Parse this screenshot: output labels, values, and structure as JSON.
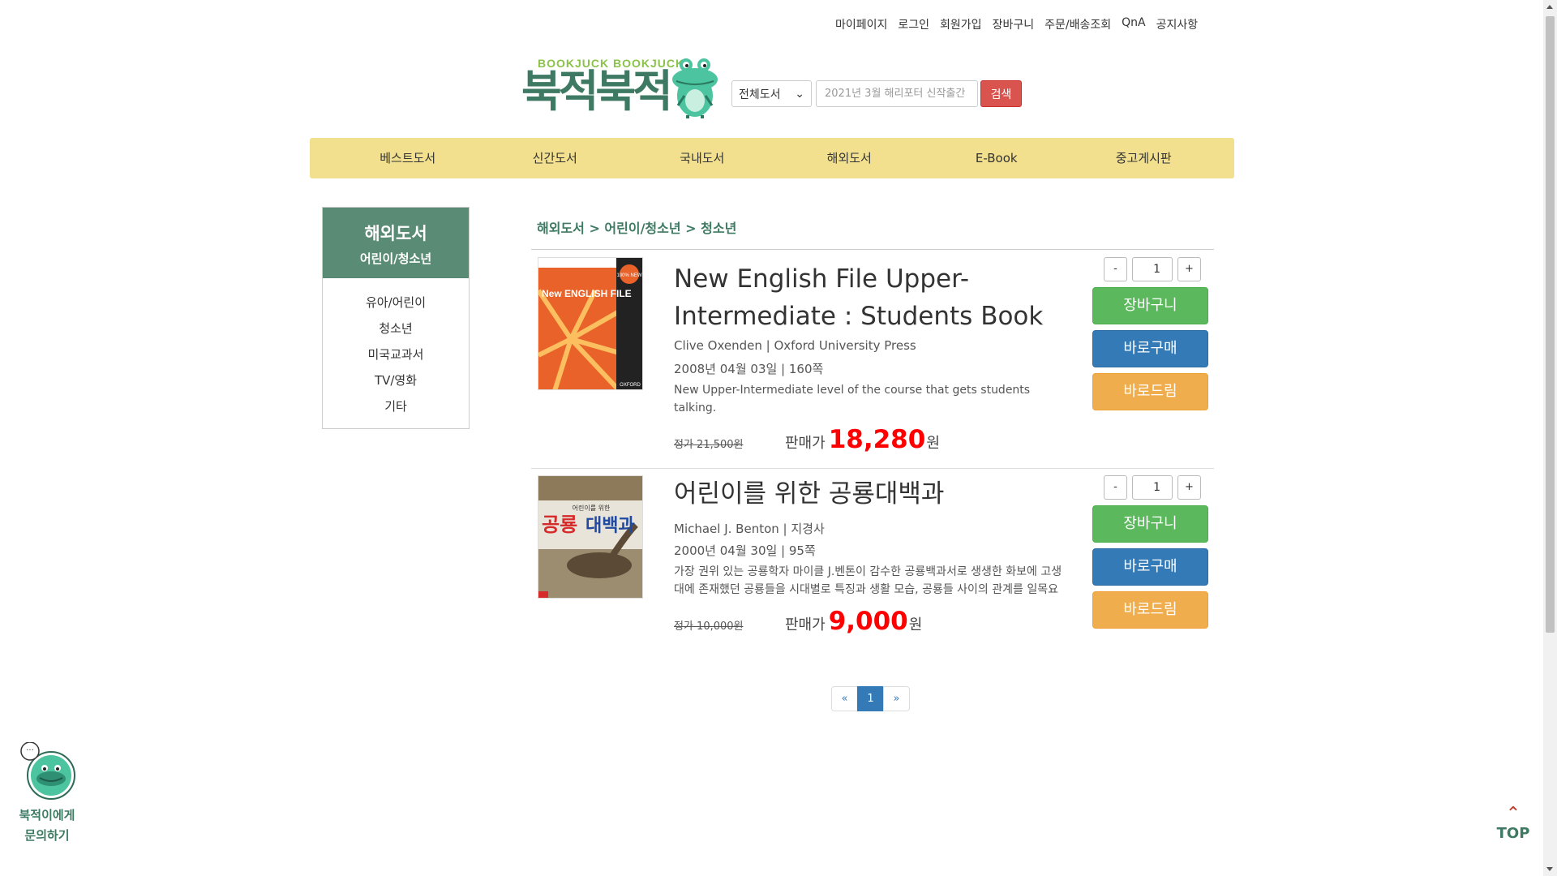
{
  "util_nav": [
    "마이페이지",
    "로그인",
    "회원가입",
    "장바구니",
    "주문/배송조회",
    "QnA",
    "공지사항"
  ],
  "logo": {
    "sub": "BOOKJUCK BOOKJUCK",
    "main": "북적북적",
    "brand_color": "#3e7a63"
  },
  "search": {
    "category": "전체도서",
    "placeholder": "2021년 3월 해리포터 신작출간",
    "button": "검색"
  },
  "menu": [
    "베스트도서",
    "신간도서",
    "국내도서",
    "해외도서",
    "E-Book",
    "중고게시판"
  ],
  "sidebar": {
    "title": "해외도서",
    "subtitle": "어린이/청소년",
    "items": [
      "유아/어린이",
      "청소년",
      "미국교과서",
      "TV/영화",
      "기타"
    ]
  },
  "breadcrumb": "해외도서 > 어린이/청소년 > 청소년",
  "products": [
    {
      "cover_icon": "book-cover-english-file",
      "cover_title": "New ENGLISH FILE",
      "cover_badge": "100% NEW",
      "cover_publisher": "OXFORD",
      "title": "New English File Upper-Intermediate : Students Book",
      "author_pub": "Clive Oxenden | Oxford University Press",
      "date_pages": "2008년 04월 03일 | 160쪽",
      "desc": "New Upper-Intermediate level of the course that gets students talking.",
      "list_price": "정가 21,500원",
      "sale_label": "판매가",
      "sale_price": "18,280",
      "won": "원",
      "qty": "1",
      "minus": "-",
      "plus": "+",
      "btn_cart": "장바구니",
      "btn_buy": "바로구매",
      "btn_gift": "바로드림"
    },
    {
      "cover_icon": "book-cover-dinosaur-encyclopedia",
      "cover_small": "어린이를 위한",
      "cover_title_a": "공룡",
      "cover_title_b": "대백과",
      "title": "어린이를 위한 공룡대백과",
      "author_pub": "Michael J. Benton | 지경사",
      "date_pages": "2000년 04월 30일 | 95쪽",
      "desc": "가장 권위 있는 공룡학자 마이클 J.벤톤이 감수한 공룡백과서로 생생한 화보에 고생대에 존재했던 공룡들을 시대별로 특징과 생활 모습, 공룡들 사이의 관계를 일목요",
      "list_price": "정가 10,000원",
      "sale_label": "판매가",
      "sale_price": "9,000",
      "won": "원",
      "qty": "1",
      "minus": "-",
      "plus": "+",
      "btn_cart": "장바구니",
      "btn_buy": "바로구매",
      "btn_gift": "바로드림"
    }
  ],
  "pager": {
    "prev": "«",
    "current": "1",
    "next": "»"
  },
  "chat": {
    "line1": "북적이에게",
    "line2": "문의하기",
    "bubble": "···"
  },
  "top_button": {
    "arrow": "⌃",
    "label": "TOP"
  },
  "colors": {
    "menu_bg": "#f2e08f",
    "sidebar_head": "#5a8b74",
    "price": "#ff0000",
    "search_btn": "#d9534f"
  }
}
